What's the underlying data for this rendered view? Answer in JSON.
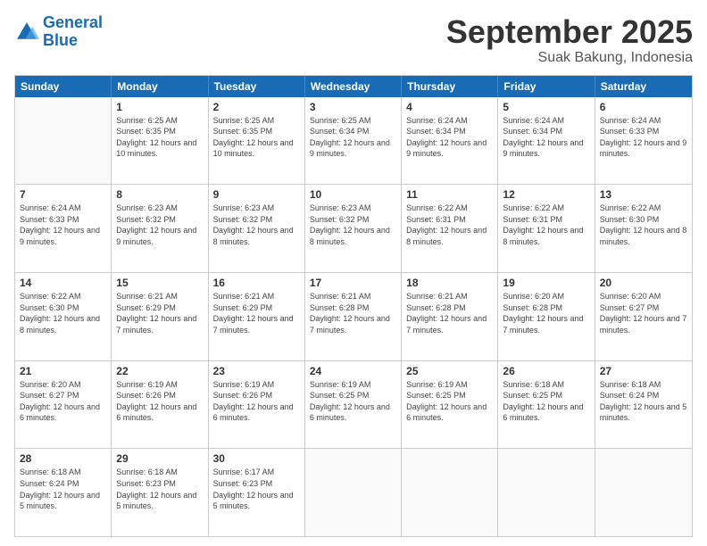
{
  "logo": {
    "general": "General",
    "blue": "Blue"
  },
  "title": "September 2025",
  "subtitle": "Suak Bakung, Indonesia",
  "header_days": [
    "Sunday",
    "Monday",
    "Tuesday",
    "Wednesday",
    "Thursday",
    "Friday",
    "Saturday"
  ],
  "weeks": [
    [
      {
        "day": "",
        "empty": true
      },
      {
        "day": "1",
        "sunrise": "6:25 AM",
        "sunset": "6:35 PM",
        "daylight": "12 hours and 10 minutes."
      },
      {
        "day": "2",
        "sunrise": "6:25 AM",
        "sunset": "6:35 PM",
        "daylight": "12 hours and 10 minutes."
      },
      {
        "day": "3",
        "sunrise": "6:25 AM",
        "sunset": "6:34 PM",
        "daylight": "12 hours and 9 minutes."
      },
      {
        "day": "4",
        "sunrise": "6:24 AM",
        "sunset": "6:34 PM",
        "daylight": "12 hours and 9 minutes."
      },
      {
        "day": "5",
        "sunrise": "6:24 AM",
        "sunset": "6:34 PM",
        "daylight": "12 hours and 9 minutes."
      },
      {
        "day": "6",
        "sunrise": "6:24 AM",
        "sunset": "6:33 PM",
        "daylight": "12 hours and 9 minutes."
      }
    ],
    [
      {
        "day": "7",
        "sunrise": "6:24 AM",
        "sunset": "6:33 PM",
        "daylight": "12 hours and 9 minutes."
      },
      {
        "day": "8",
        "sunrise": "6:23 AM",
        "sunset": "6:32 PM",
        "daylight": "12 hours and 9 minutes."
      },
      {
        "day": "9",
        "sunrise": "6:23 AM",
        "sunset": "6:32 PM",
        "daylight": "12 hours and 8 minutes."
      },
      {
        "day": "10",
        "sunrise": "6:23 AM",
        "sunset": "6:32 PM",
        "daylight": "12 hours and 8 minutes."
      },
      {
        "day": "11",
        "sunrise": "6:22 AM",
        "sunset": "6:31 PM",
        "daylight": "12 hours and 8 minutes."
      },
      {
        "day": "12",
        "sunrise": "6:22 AM",
        "sunset": "6:31 PM",
        "daylight": "12 hours and 8 minutes."
      },
      {
        "day": "13",
        "sunrise": "6:22 AM",
        "sunset": "6:30 PM",
        "daylight": "12 hours and 8 minutes."
      }
    ],
    [
      {
        "day": "14",
        "sunrise": "6:22 AM",
        "sunset": "6:30 PM",
        "daylight": "12 hours and 8 minutes."
      },
      {
        "day": "15",
        "sunrise": "6:21 AM",
        "sunset": "6:29 PM",
        "daylight": "12 hours and 7 minutes."
      },
      {
        "day": "16",
        "sunrise": "6:21 AM",
        "sunset": "6:29 PM",
        "daylight": "12 hours and 7 minutes."
      },
      {
        "day": "17",
        "sunrise": "6:21 AM",
        "sunset": "6:28 PM",
        "daylight": "12 hours and 7 minutes."
      },
      {
        "day": "18",
        "sunrise": "6:21 AM",
        "sunset": "6:28 PM",
        "daylight": "12 hours and 7 minutes."
      },
      {
        "day": "19",
        "sunrise": "6:20 AM",
        "sunset": "6:28 PM",
        "daylight": "12 hours and 7 minutes."
      },
      {
        "day": "20",
        "sunrise": "6:20 AM",
        "sunset": "6:27 PM",
        "daylight": "12 hours and 7 minutes."
      }
    ],
    [
      {
        "day": "21",
        "sunrise": "6:20 AM",
        "sunset": "6:27 PM",
        "daylight": "12 hours and 6 minutes."
      },
      {
        "day": "22",
        "sunrise": "6:19 AM",
        "sunset": "6:26 PM",
        "daylight": "12 hours and 6 minutes."
      },
      {
        "day": "23",
        "sunrise": "6:19 AM",
        "sunset": "6:26 PM",
        "daylight": "12 hours and 6 minutes."
      },
      {
        "day": "24",
        "sunrise": "6:19 AM",
        "sunset": "6:25 PM",
        "daylight": "12 hours and 6 minutes."
      },
      {
        "day": "25",
        "sunrise": "6:19 AM",
        "sunset": "6:25 PM",
        "daylight": "12 hours and 6 minutes."
      },
      {
        "day": "26",
        "sunrise": "6:18 AM",
        "sunset": "6:25 PM",
        "daylight": "12 hours and 6 minutes."
      },
      {
        "day": "27",
        "sunrise": "6:18 AM",
        "sunset": "6:24 PM",
        "daylight": "12 hours and 5 minutes."
      }
    ],
    [
      {
        "day": "28",
        "sunrise": "6:18 AM",
        "sunset": "6:24 PM",
        "daylight": "12 hours and 5 minutes."
      },
      {
        "day": "29",
        "sunrise": "6:18 AM",
        "sunset": "6:23 PM",
        "daylight": "12 hours and 5 minutes."
      },
      {
        "day": "30",
        "sunrise": "6:17 AM",
        "sunset": "6:23 PM",
        "daylight": "12 hours and 5 minutes."
      },
      {
        "day": "",
        "empty": true
      },
      {
        "day": "",
        "empty": true
      },
      {
        "day": "",
        "empty": true
      },
      {
        "day": "",
        "empty": true
      }
    ]
  ]
}
